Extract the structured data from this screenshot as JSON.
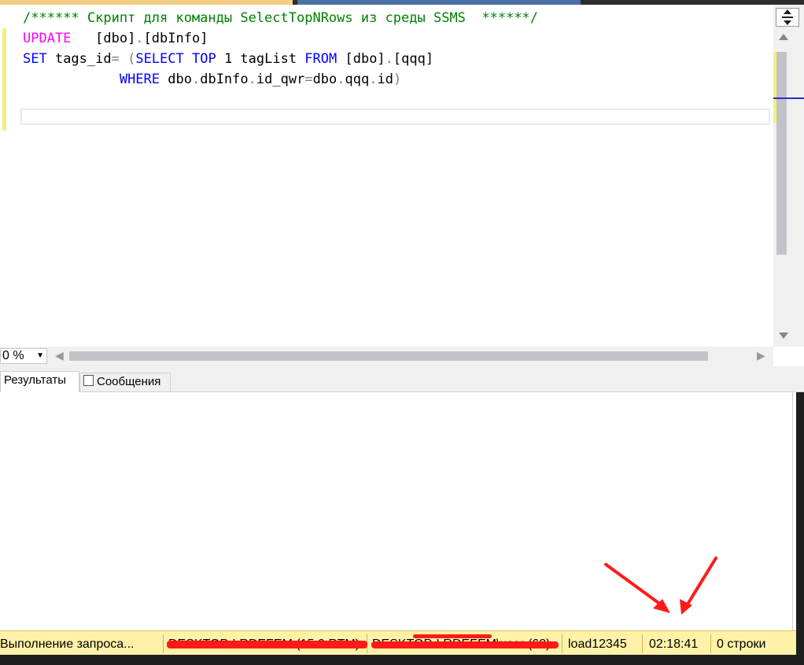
{
  "editor": {
    "line1_comment": "/****** Скрипт для команды SelectTopNRows из среды SSMS  ******/",
    "line2_kw": "UPDATE",
    "line2_rest": "   [dbo]",
    "line2_dot": ".",
    "line2_table": "[dbInfo]",
    "line3_kw": "SET",
    "line3_col": " tags_id",
    "line3_eq": "= (",
    "line3_select": "SELECT",
    "line3_top": " TOP",
    "line3_num": " 1 tagList ",
    "line3_from": "FROM",
    "line3_src": " [dbo]",
    "line3_dot": ".",
    "line3_tbl": "[qqq]",
    "line4_indent": "            ",
    "line4_where": "WHERE",
    "line4_expr": " dbo",
    "line4_d1": ".",
    "line4_e2": "dbInfo",
    "line4_d2": ".",
    "line4_e3": "id_qwr",
    "line4_eq": "=",
    "line4_e4": "dbo",
    "line4_d3": ".",
    "line4_e5": "qqq",
    "line4_d4": ".",
    "line4_e6": "id",
    "line4_close": ")"
  },
  "zoom": {
    "value": "0 %"
  },
  "result_tabs": {
    "results": "Результаты",
    "messages": "Сообщения"
  },
  "status": {
    "query_state": "Выполнение запроса...",
    "server": "DESKTOP-LRDEFEM (15.0 RTM)",
    "login": "DESKTOP-LRDEFEM\\user (62)",
    "database": "load12345",
    "elapsed": "02:18:41",
    "rows": "0 строки"
  },
  "colors": {
    "keyword_blue": "#0000ff",
    "keyword_magenta": "#ff00ff",
    "comment_green": "#008000",
    "status_bar": "#fff2a8",
    "annotation_red": "#ff1a1a"
  }
}
